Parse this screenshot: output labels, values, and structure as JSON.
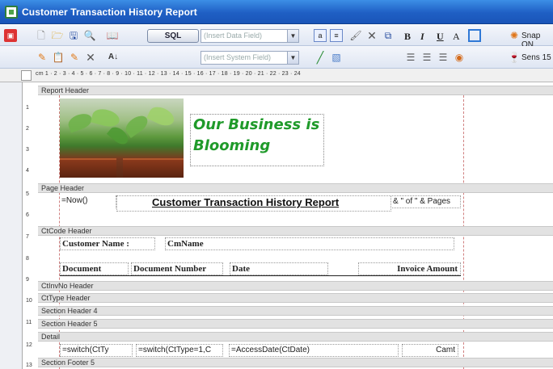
{
  "window": {
    "title": "Customer Transaction History Report"
  },
  "toolbar1": {
    "sql_label": "SQL",
    "data_field_placeholder": "(Insert Data Field)",
    "bold": "B",
    "italic": "I",
    "underline": "U",
    "font_color": "A",
    "snap_label": "Snap ON"
  },
  "toolbar2": {
    "system_field_placeholder": "(Insert System Field)",
    "sens_label": "Sens 15"
  },
  "ruler": {
    "units": "cm",
    "ticks": "1 · 2 · 3 · 4 · 5 · 6 · 7 · 8 · 9 · 10 · 11 · 12 · 13 · 14 · 15 · 16 · 17 · 18 · 19 · 20 · 21 · 22 · 23 · 24",
    "left": [
      "1",
      "2",
      "3",
      "4",
      "5",
      "6",
      "7",
      "8",
      "9",
      "10",
      "11",
      "12",
      "13"
    ]
  },
  "bands": {
    "report_header": "Report Header",
    "page_header": "Page Header",
    "ctcode_header": "CtCode Header",
    "ctinvno_header": "CtInvNo Header",
    "cttype_header": "CtType Header",
    "section_header_4": "Section Header 4",
    "section_header_5": "Section Header 5",
    "detail": "Detail",
    "section_footer_5": "Section Footer 5"
  },
  "report_header": {
    "tagline": "Our Business is Blooming"
  },
  "page_header": {
    "now_field": "=Now()",
    "report_title": "Customer Transaction History Report",
    "page_field": "& \" of \" & Pages"
  },
  "ctcode_header": {
    "customer_name_label": "Customer Name :",
    "customer_name_field": "CmName",
    "col_document": "Document",
    "col_document_number": "Document Number",
    "col_date": "Date",
    "col_invoice_amount": "Invoice Amount"
  },
  "detail": {
    "field1": "=switch(CtTy",
    "field2": "=switch(CtType=1,C",
    "field3": "=AccessDate(CtDate)",
    "field4": "Camt"
  }
}
